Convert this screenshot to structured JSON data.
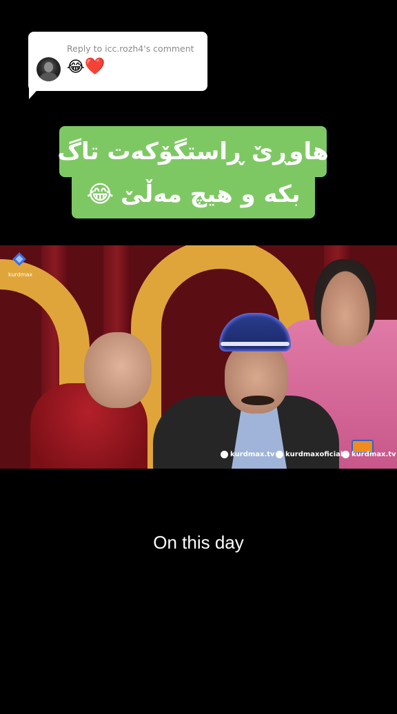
{
  "reply": {
    "header": "Reply to icc.rozh4's comment",
    "text_laugh": "😂",
    "text_heart": "❤️",
    "avatar_icon": "user-avatar-icon"
  },
  "caption": {
    "line1": "هاوڕێ ڕاستگۆکەت تاگ",
    "line2_text": "بکە و هیچ مەڵێ",
    "line2_emoji": "😂",
    "background_color": "#7ec864"
  },
  "video": {
    "channel_logo_text": "kurdmax",
    "watermarks": [
      "kurdmax.tv",
      "kurdmaxoficial",
      "kurdmax.tv"
    ]
  },
  "footer": {
    "on_this_day": "On this day"
  }
}
